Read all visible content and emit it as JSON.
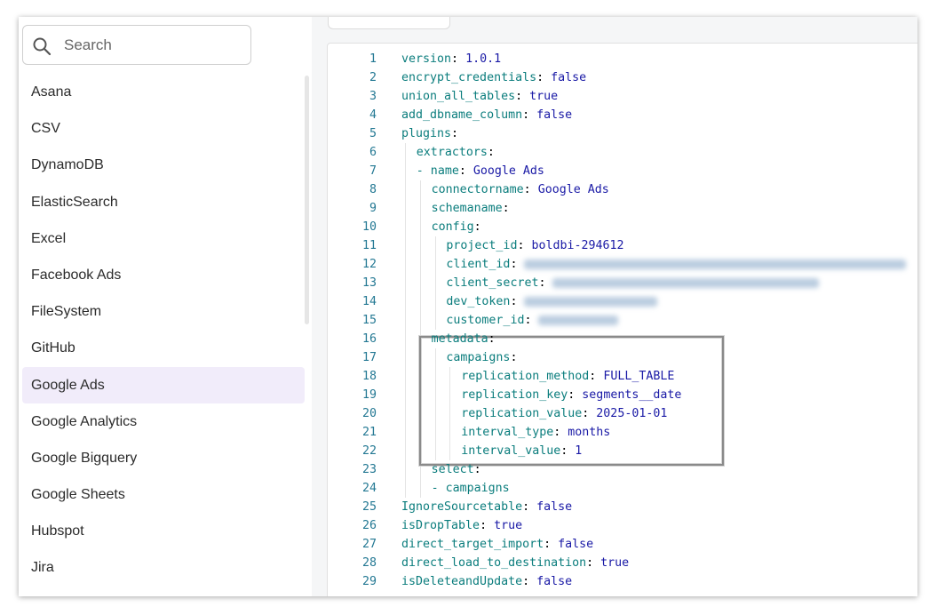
{
  "search": {
    "placeholder": "Search",
    "icon": "search-icon"
  },
  "sidebar": {
    "items": [
      {
        "label": "Asana"
      },
      {
        "label": "CSV"
      },
      {
        "label": "DynamoDB"
      },
      {
        "label": "ElasticSearch"
      },
      {
        "label": "Excel"
      },
      {
        "label": "Facebook Ads"
      },
      {
        "label": "FileSystem"
      },
      {
        "label": "GitHub"
      },
      {
        "label": "Google Ads",
        "active": true
      },
      {
        "label": "Google Analytics"
      },
      {
        "label": "Google Bigquery"
      },
      {
        "label": "Google Sheets"
      },
      {
        "label": "Hubspot"
      },
      {
        "label": "Jira"
      }
    ],
    "active_color": "#f1ecfa"
  },
  "editor": {
    "key_color": "#0b7d7d",
    "value_color": "#1a1aa6",
    "lines": [
      {
        "n": "1",
        "indent": 0,
        "key": "version",
        "sep": ": ",
        "val": "1.0.1"
      },
      {
        "n": "2",
        "indent": 0,
        "key": "encrypt_credentials",
        "sep": ": ",
        "val": "false"
      },
      {
        "n": "3",
        "indent": 0,
        "key": "union_all_tables",
        "sep": ": ",
        "val": "true"
      },
      {
        "n": "4",
        "indent": 0,
        "key": "add_dbname_column",
        "sep": ": ",
        "val": "false"
      },
      {
        "n": "5",
        "indent": 0,
        "key": "plugins",
        "sep": ":",
        "val": ""
      },
      {
        "n": "6",
        "indent": 1,
        "key": "extractors",
        "sep": ":",
        "val": ""
      },
      {
        "n": "7",
        "indent": 1,
        "key": "- name",
        "sep": ": ",
        "val": "Google Ads"
      },
      {
        "n": "8",
        "indent": 2,
        "key": "connectorname",
        "sep": ": ",
        "val": "Google Ads"
      },
      {
        "n": "9",
        "indent": 2,
        "key": "schemaname",
        "sep": ":",
        "val": ""
      },
      {
        "n": "10",
        "indent": 2,
        "key": "config",
        "sep": ":",
        "val": ""
      },
      {
        "n": "11",
        "indent": 3,
        "key": "project_id",
        "sep": ": ",
        "val": "boldbi-294612"
      },
      {
        "n": "12",
        "indent": 3,
        "key": "client_id",
        "sep": ": ",
        "val": "",
        "redacted": true
      },
      {
        "n": "13",
        "indent": 3,
        "key": "client_secret",
        "sep": ": ",
        "val": "",
        "redacted": true
      },
      {
        "n": "14",
        "indent": 3,
        "key": "dev_token",
        "sep": ": ",
        "val": "",
        "redacted": true
      },
      {
        "n": "15",
        "indent": 3,
        "key": "customer_id",
        "sep": ": ",
        "val": "",
        "redacted": true
      },
      {
        "n": "16",
        "indent": 2,
        "key": "metadata",
        "sep": ":",
        "val": ""
      },
      {
        "n": "17",
        "indent": 3,
        "key": "campaigns",
        "sep": ":",
        "val": ""
      },
      {
        "n": "18",
        "indent": 4,
        "key": "replication_method",
        "sep": ": ",
        "val": "FULL_TABLE"
      },
      {
        "n": "19",
        "indent": 4,
        "key": "replication_key",
        "sep": ": ",
        "val": "segments__date"
      },
      {
        "n": "20",
        "indent": 4,
        "key": "replication_value",
        "sep": ": ",
        "val": "2025-01-01"
      },
      {
        "n": "21",
        "indent": 4,
        "key": "interval_type",
        "sep": ": ",
        "val": "months"
      },
      {
        "n": "22",
        "indent": 4,
        "key": "interval_value",
        "sep": ": ",
        "val": "1"
      },
      {
        "n": "23",
        "indent": 2,
        "key": "select",
        "sep": ":",
        "val": ""
      },
      {
        "n": "24",
        "indent": 2,
        "key": "- campaigns",
        "sep": "",
        "val": ""
      },
      {
        "n": "25",
        "indent": 0,
        "key": "IgnoreSourcetable",
        "sep": ": ",
        "val": "false"
      },
      {
        "n": "26",
        "indent": 0,
        "key": "isDropTable",
        "sep": ": ",
        "val": "true"
      },
      {
        "n": "27",
        "indent": 0,
        "key": "direct_target_import",
        "sep": ": ",
        "val": "false"
      },
      {
        "n": "28",
        "indent": 0,
        "key": "direct_load_to_destination",
        "sep": ": ",
        "val": "true"
      },
      {
        "n": "29",
        "indent": 0,
        "key": "isDeleteandUpdate",
        "sep": ": ",
        "val": "false"
      }
    ]
  }
}
